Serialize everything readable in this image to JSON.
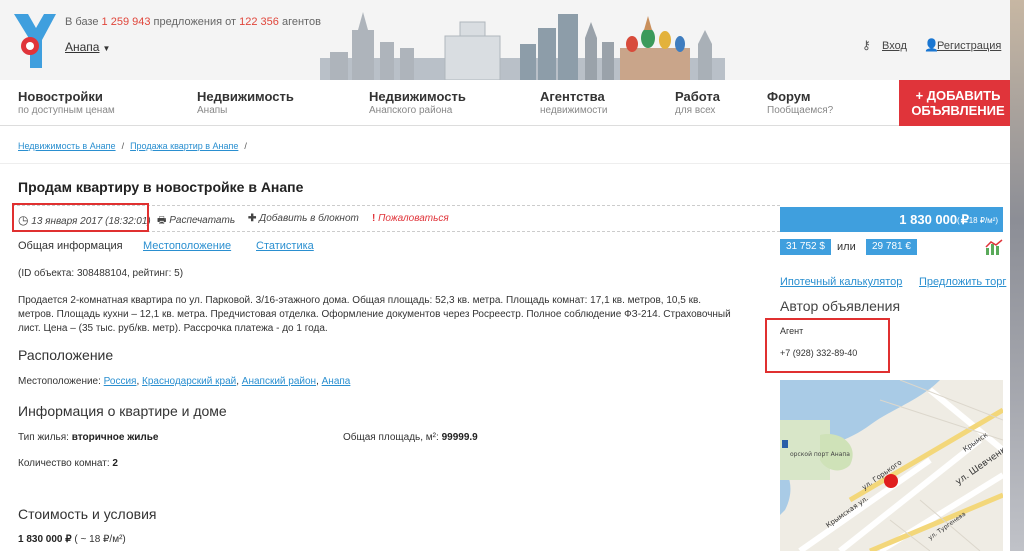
{
  "header": {
    "stats_prefix": "В базе",
    "offers_count": "1 259 943",
    "stats_middle": "предложения от",
    "agents_count": "122 356",
    "stats_suffix": "агентов",
    "city": "Анапа",
    "login": "Вход",
    "register": "Регистрация"
  },
  "nav": [
    {
      "title": "Новостройки",
      "sub": "по доступным ценам"
    },
    {
      "title": "Недвижимость",
      "sub": "Анапы"
    },
    {
      "title": "Недвижимость",
      "sub": "Анапского района"
    },
    {
      "title": "Агентства",
      "sub": "недвижимости"
    },
    {
      "title": "Работа",
      "sub": "для всех"
    },
    {
      "title": "Форум",
      "sub": "Пообщаемся?"
    }
  ],
  "add_button": {
    "line1": "+ ДОБАВИТЬ",
    "line2": "ОБЪЯВЛЕНИЕ"
  },
  "breadcrumb": {
    "item1": "Недвижимость в Анапе",
    "item2": "Продажа квартир в Анапе",
    "sep": "/"
  },
  "listing": {
    "title": "Продам квартиру в новостройке в Анапе",
    "date": "13 января 2017 (18:32:01)",
    "print": "Распечатать",
    "notebook": "Добавить в блокнот",
    "complain": "Пожаловаться",
    "tabs": [
      "Общая информация",
      "Местоположение",
      "Статистика"
    ],
    "id_line": "(ID объекта: 308488104, рейтинг: 5)",
    "description": "Продается 2-комнатная квартира по ул. Парковой. 3/16-этажного дома. Общая площадь: 52,3 кв. метра. Площадь комнат: 17,1 кв. метров, 10,5 кв. метров. Площадь кухни – 12,1 кв. метра. Предчистовая отделка. Оформление документов через Росреестр. Полное соблюдение ФЗ-214. Страховочный лист. Цена – (35 тыс. руб/кв. метр). Рассрочка платежа - до 1 года.",
    "location_heading": "Расположение",
    "location_label": "Местоположение:",
    "location_parts": [
      "Россия",
      "Краснодарский край",
      "Анапский район",
      "Анапа"
    ],
    "info_heading": "Информация о квартире и доме",
    "housing_type_label": "Тип жилья:",
    "housing_type": "вторичное жилье",
    "area_label": "Общая площадь, м²:",
    "area": "99999.9",
    "rooms_label": "Количество комнат:",
    "rooms": "2",
    "cost_heading": "Стоимость и условия",
    "cost_value": "1 830 000 ₽",
    "cost_per_m": "( ~ 18 ₽/м²)"
  },
  "price": {
    "main": "1 830 000 ₽",
    "per_m": "( ~ 18 ₽/м²)",
    "usd": "31 752 $",
    "or": "или",
    "eur": "29 781 €"
  },
  "sidebar": {
    "mortgage": "Ипотечный калькулятор",
    "offer": "Предложить торг",
    "author_title": "Автор объявления",
    "agent_label": "Агент",
    "agent_phone": "+7 (928) 332-89-40"
  },
  "map": {
    "street1": "ул. Горького",
    "street2": "Крымская ул.",
    "street3": "ул. Шевченко",
    "street4": "Крымск",
    "street5": "ул. Тургенева",
    "port": "орской порт Анапа"
  },
  "colors": {
    "accent": "#3f9fde",
    "brand_red": "#e0343a",
    "link": "#2a8fd0"
  }
}
